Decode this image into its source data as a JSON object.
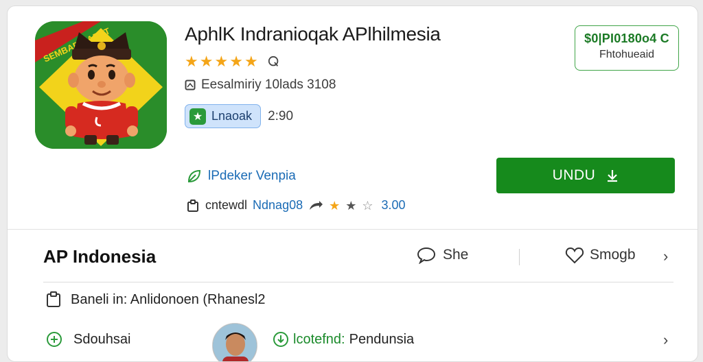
{
  "app": {
    "title": "AphlK Indranioqak APlhilmesia",
    "rating_stars": 5,
    "meta_text": "Eesalmiriy 10lads 3108",
    "badge_label": "Lnaoak",
    "badge_time": "2:90",
    "icon_banner_text": "SEMBAR BARAT"
  },
  "price": {
    "amount": "$0|PI0180o4 C",
    "sub": "Fhtohueaid"
  },
  "developer": {
    "label": "lPdeker Venpia"
  },
  "install": {
    "label": "UNDU"
  },
  "stats": {
    "prefix": "cntewdl",
    "link": "Ndnag08",
    "rating_value": "3.00",
    "stars": [
      1,
      1,
      0
    ]
  },
  "section": {
    "title": "AP Indonesia",
    "share_label": "She",
    "wishlist_label": "Smogb"
  },
  "details": {
    "line1": "Baneli in: Anlidonoen (Rhanesl2",
    "left_label": "Sdouhsai",
    "mid_prefix": "lcotefnd:",
    "mid_value": "Pendunsia"
  },
  "colors": {
    "accent_green": "#168a1c",
    "star": "#f4a518",
    "link": "#1a6bb5"
  }
}
